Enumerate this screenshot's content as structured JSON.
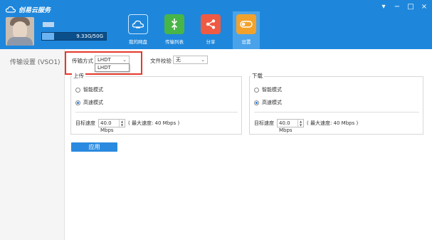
{
  "app": {
    "title": "创易云服务",
    "window_controls": [
      "▾",
      "−",
      "□",
      "×"
    ]
  },
  "user": {
    "quota_text": "9.33G/50G",
    "quota_fraction": 0.19
  },
  "nav": [
    {
      "label": "我的网盘",
      "icon": "cloud-drive-icon",
      "color": "#1e87db"
    },
    {
      "label": "传输列表",
      "icon": "transfer-arrows-icon",
      "color": "#48b548"
    },
    {
      "label": "分享",
      "icon": "share-icon",
      "color": "#ef5a43"
    },
    {
      "label": "设置",
      "icon": "settings-toggle-icon",
      "color": "#f2a22c",
      "selected": true
    }
  ],
  "sidebar": {
    "item": "传输设置 (VSO1)"
  },
  "settings": {
    "transfer_mode_label": "传输方式",
    "transfer_mode_value": "LHDT",
    "dropdown_option": "LHDT",
    "file_check_label": "文件校验",
    "file_check_value": "无"
  },
  "upload": {
    "title": "上传",
    "option_smart": "智能模式",
    "option_fast": "高速模式",
    "target_label": "目标速度",
    "target_value": "40.0 Mbps",
    "max_speed_text": "( 最大速度: 40 Mbps )"
  },
  "download": {
    "title": "下载",
    "option_smart": "智能模式",
    "option_fast": "高速模式",
    "target_label": "目标速度",
    "target_value": "40.0 Mbps",
    "max_speed_text": "( 最大速度: 40 Mbps )"
  },
  "apply_label": "应用",
  "colors": {
    "topbar": "#1e87db",
    "highlight": "#e4392b",
    "apply": "#2a8ae0"
  }
}
